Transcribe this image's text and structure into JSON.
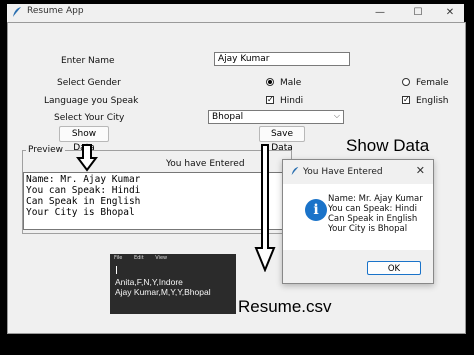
{
  "window": {
    "title": "Resume App",
    "minimize_glyph": "—",
    "maximize_glyph": "☐",
    "close_glyph": "✕"
  },
  "form": {
    "name_label": "Enter Name",
    "name_value": "Ajay Kumar",
    "gender_label": "Select Gender",
    "gender_options": [
      "Male",
      "Female"
    ],
    "gender_selected": "Male",
    "language_label": "Language you Speak",
    "language_options": [
      "Hindi",
      "English"
    ],
    "language_checked": [
      "Hindi",
      "English"
    ],
    "city_label": "Select Your City",
    "city_value": "Bhopal",
    "show_data_label": "Show Data",
    "save_data_label": "Save Data"
  },
  "preview": {
    "legend": "Preview",
    "header": "You have Entered",
    "lines": [
      "Name: Mr. Ajay Kumar",
      "You can Speak: Hindi",
      "Can Speak in English",
      "Your City is Bhopal"
    ]
  },
  "dialog": {
    "title": "You Have Entered",
    "lines": [
      "Name: Mr. Ajay Kumar",
      "You can Speak: Hindi",
      "Can Speak in English",
      "Your City is Bhopal"
    ],
    "ok_label": "OK",
    "icon": "info-icon"
  },
  "notepad": {
    "menu": [
      "File",
      "Edit",
      "View"
    ],
    "lines": [
      "Anita,F,N,Y,Indore",
      "Ajay Kumar,M,Y,Y,Bhopal"
    ]
  },
  "annotations": {
    "show_data": "Show Data",
    "resume_csv": "Resume.csv"
  },
  "colors": {
    "accent": "#1a73c9",
    "window_bg": "#f0f0f0"
  }
}
